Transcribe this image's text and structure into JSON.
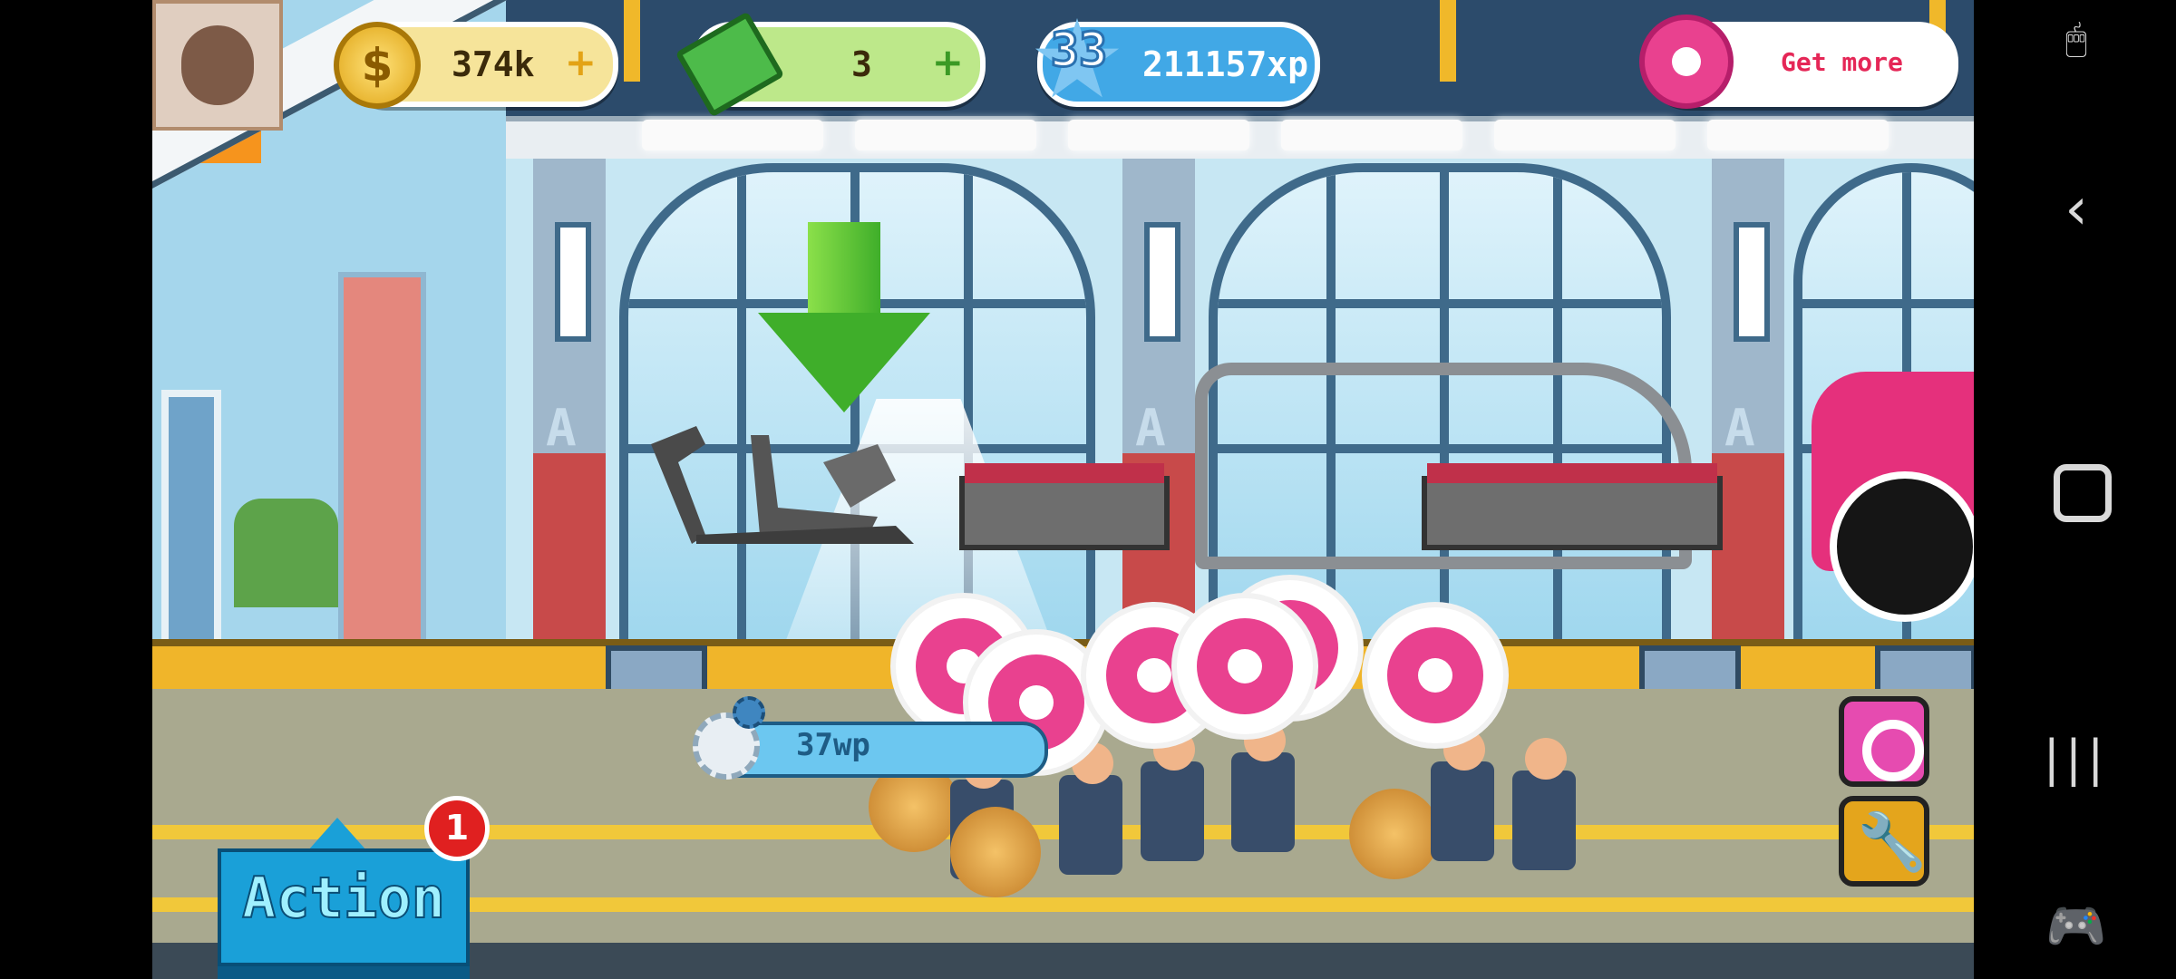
{
  "hud": {
    "coins": "374k",
    "coins_plus": "+",
    "cash": "3",
    "cash_plus": "+",
    "level": "33",
    "xp": "211157xp",
    "donut_button": "Get more",
    "coin_symbol": "$"
  },
  "workpoints": {
    "value": "37wp"
  },
  "action": {
    "label": "Action",
    "badge": "1"
  },
  "right_buttons": {
    "donut_icon": "donut-icon",
    "wrench_symbol": "🔧"
  },
  "nav": {
    "cursor_icon": "🖱",
    "back_icon": "‹",
    "recent_icon": "|||",
    "game_icon": "🎮"
  },
  "scene": {
    "wall_marks": [
      "A",
      "A",
      "A"
    ]
  }
}
